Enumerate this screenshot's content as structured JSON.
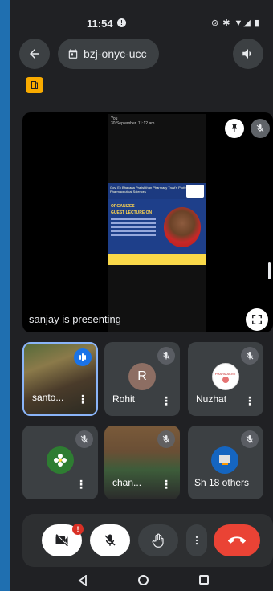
{
  "status_bar": {
    "time": "11:54",
    "notif": "!"
  },
  "header": {
    "meeting_code": "bzj-onyc-ucc"
  },
  "presentation": {
    "label": "sanjay is presenting",
    "phone_sender": "You",
    "phone_date": "30 September, 11:12 am",
    "poster_header": "Gov. Ex Bhavana Pratishthan Pharmacy Trust's Professional Pharmaceutical Sciences",
    "poster_org": "ORGANIZES",
    "poster_guest": "GUEST LECTURE ON",
    "poster_logo": "pratishthana"
  },
  "participants": [
    {
      "name": "santo...",
      "state": "speaking"
    },
    {
      "name": "Rohit",
      "avatar_letter": "R",
      "avatar_color": "#8d6e63",
      "state": "muted"
    },
    {
      "name": "Nuzhat",
      "state": "muted"
    },
    {
      "name": "",
      "state": "muted"
    },
    {
      "name": "chan...",
      "state": "muted"
    },
    {
      "name": "Sh",
      "extra": "18 others",
      "state": "muted"
    }
  ],
  "controls": {
    "camera_badge": "!"
  },
  "colors": {
    "accent": "#8ab4f8",
    "leave": "#ea4335",
    "speaking": "#1a73e8"
  }
}
